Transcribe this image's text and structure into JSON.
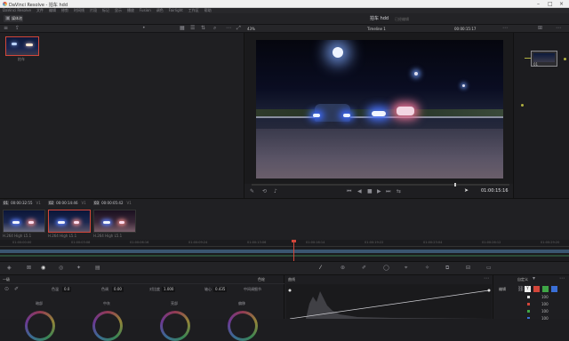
{
  "window": {
    "title": "DaVinci Resolve - 拍车 hdd"
  },
  "menu": {
    "items": [
      "DaVinci Resolve",
      "文件",
      "编辑",
      "修剪",
      "时间线",
      "片段",
      "标记",
      "显示",
      "播放",
      "Fusion",
      "调色",
      "Fairlight",
      "工作区",
      "帮助"
    ]
  },
  "project": {
    "name": "拍车 hdd",
    "status": "已经编辑"
  },
  "toolbar": {
    "media_pool": "媒体池",
    "lut": "LUT",
    "gallery": "静态画廊"
  },
  "media_pool": {
    "clip_label": "拍车"
  },
  "viewer": {
    "zoom": "43%",
    "timeline_name": "Timeline 1",
    "timecode_top": "00:00:15:17",
    "timecode": "01:00:15:16"
  },
  "clips": [
    {
      "num": "01",
      "tc": "00:00:32:55",
      "track": "V1",
      "codec": "H.264 High L5.1"
    },
    {
      "num": "02",
      "tc": "00:00:14:46",
      "track": "V1",
      "codec": "H.264 High L5.1"
    },
    {
      "num": "03",
      "tc": "00:00:05:42",
      "track": "V1",
      "codec": "H.264 High L5.1"
    }
  ],
  "timeline_ruler": [
    "01:00:00:00",
    "01:00:03:08",
    "01:00:06:16",
    "01:00:09:24",
    "01:00:13:06",
    "01:00:16:14",
    "01:00:19:22",
    "01:00:23:04",
    "01:00:26:12",
    "01:00:29:20"
  ],
  "wheels": {
    "mode": "一级",
    "tab": "色轮",
    "params": [
      {
        "label": "对比度",
        "value": "1.000"
      },
      {
        "label": "轴心",
        "value": "0.435"
      },
      {
        "label": "中间调细节",
        "value": ""
      }
    ],
    "temp_label": "色温",
    "temp_value": "0.0",
    "tint_label": "色调",
    "tint_value": "0.00",
    "names": [
      "暗部",
      "中灰",
      "亮部",
      "偏移"
    ]
  },
  "curves": {
    "title": "曲线"
  },
  "hsl": {
    "title": "自定义",
    "sub": "编辑",
    "values": [
      "100",
      "100",
      "100",
      "100"
    ]
  },
  "colors": {
    "accent": "#d2463a",
    "panel": "#1e1e21",
    "text": "#9a9aa0"
  }
}
